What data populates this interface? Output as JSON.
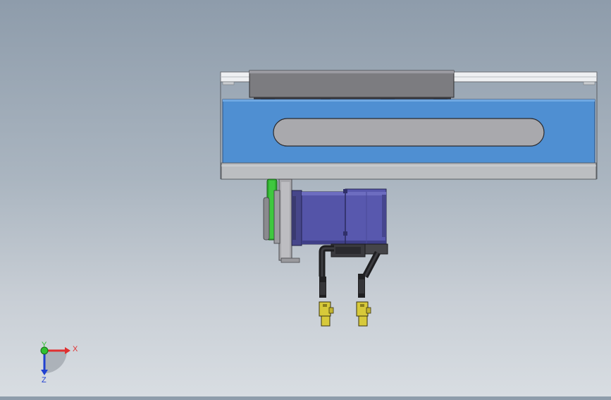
{
  "viewport": {
    "background_top": "#8e9cab",
    "background_bottom": "#d8dde2"
  },
  "model": {
    "rail_color": "#4f8fd2",
    "carriage_color": "#7c7c80",
    "motor_color": "#5454a8",
    "belt_color": "#2fae2f",
    "connector_color": "#d7c93a"
  },
  "triad": {
    "x_label": "X",
    "y_label": "Y",
    "z_label": "Z",
    "x_color": "#e03030",
    "y_color": "#30c030",
    "z_color": "#2040d0"
  }
}
